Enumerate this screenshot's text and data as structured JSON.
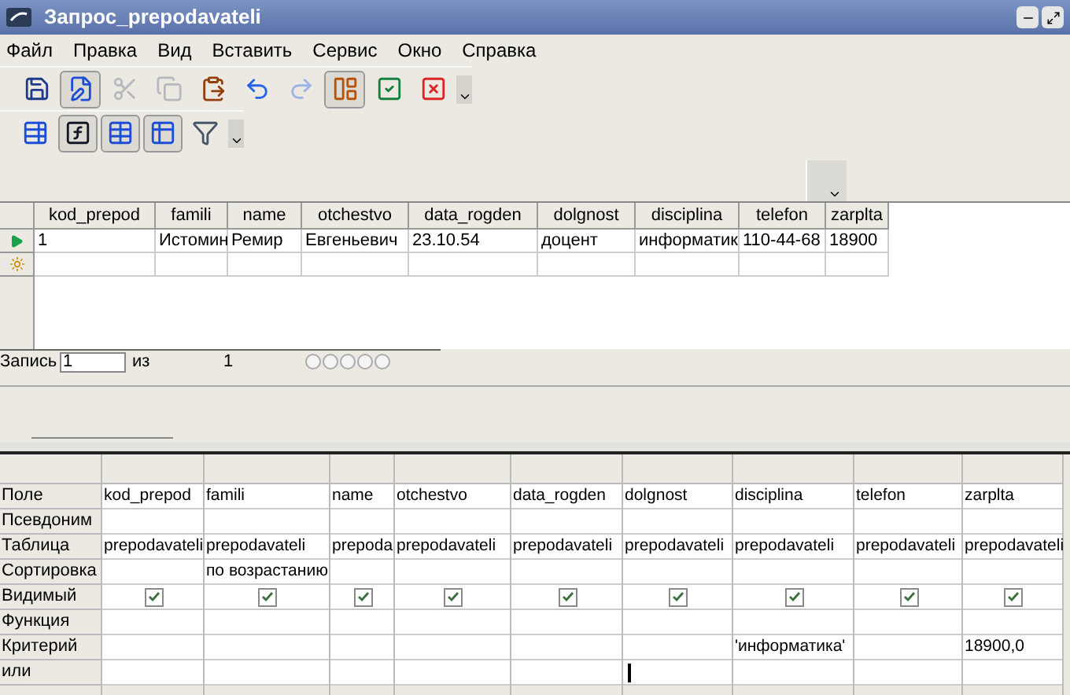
{
  "window": {
    "title": "Запрос_prepodavateli"
  },
  "menu": [
    {
      "label": "Файл"
    },
    {
      "label": "Правка"
    },
    {
      "label": "Вид"
    },
    {
      "label": "Вставить"
    },
    {
      "label": "Сервис"
    },
    {
      "label": "Окно"
    },
    {
      "label": "Справка"
    }
  ],
  "toolbar_1": [
    {
      "kind": "save",
      "pressed": false,
      "disabled": false
    },
    {
      "kind": "edit",
      "pressed": true,
      "disabled": false
    },
    {
      "kind": "cut",
      "pressed": false,
      "disabled": true
    },
    {
      "kind": "copy",
      "pressed": false,
      "disabled": true
    },
    {
      "kind": "paste",
      "pressed": false,
      "disabled": false
    },
    {
      "kind": "undo",
      "pressed": false,
      "disabled": false
    },
    {
      "kind": "redo",
      "pressed": false,
      "disabled": true
    },
    {
      "kind": "design",
      "pressed": true,
      "disabled": false
    },
    {
      "kind": "accept",
      "pressed": false,
      "disabled": false
    },
    {
      "kind": "reject",
      "pressed": false,
      "disabled": false
    }
  ],
  "toolbar_2": [
    {
      "kind": "add_table",
      "pressed": false,
      "disabled": false
    },
    {
      "kind": "function",
      "pressed": true,
      "disabled": false
    },
    {
      "kind": "alias",
      "pressed": true,
      "disabled": false
    },
    {
      "kind": "table_name",
      "pressed": true,
      "disabled": false
    },
    {
      "kind": "distinct",
      "pressed": false,
      "disabled": false
    }
  ],
  "data_grid": {
    "columns": [
      "kod_prepod",
      "famili",
      "name",
      "otchestvo",
      "data_rogden",
      "dolgnost",
      "disciplina",
      "telefon",
      "zarplta"
    ],
    "rows": [
      [
        "1",
        "Истомин",
        "Ремир",
        "Евгеньевич",
        "23.10.54",
        "доцент",
        "информатик",
        "110-44-68",
        "18900"
      ]
    ]
  },
  "record_nav": {
    "label": "Запись",
    "value": "1",
    "of": "из",
    "total": "1"
  },
  "design_grid": {
    "row_labels": [
      "Поле",
      "Псевдоним",
      "Таблица",
      "Сортировка",
      "Видимый",
      "Функция",
      "Критерий",
      "или"
    ],
    "columns": [
      {
        "field": "kod_prepod",
        "table": "prepodavateli",
        "visible": true
      },
      {
        "field": "famili",
        "table": "prepodavateli",
        "sort": "по возрастанию",
        "visible": true
      },
      {
        "field": "name",
        "table": "prepoda",
        "visible": true
      },
      {
        "field": "otchestvo",
        "table": "prepodavateli",
        "visible": true
      },
      {
        "field": "data_rogden",
        "table": "prepodavateli",
        "visible": true
      },
      {
        "field": "dolgnost",
        "table": "prepodavateli",
        "visible": true
      },
      {
        "field": "disciplina",
        "table": "prepodavateli",
        "visible": true,
        "criterion": "'информатика'"
      },
      {
        "field": "telefon",
        "table": "prepodavateli",
        "visible": true
      },
      {
        "field": "zarplta",
        "table": "prepodavateli",
        "visible": true,
        "criterion": "18900,0"
      }
    ]
  }
}
